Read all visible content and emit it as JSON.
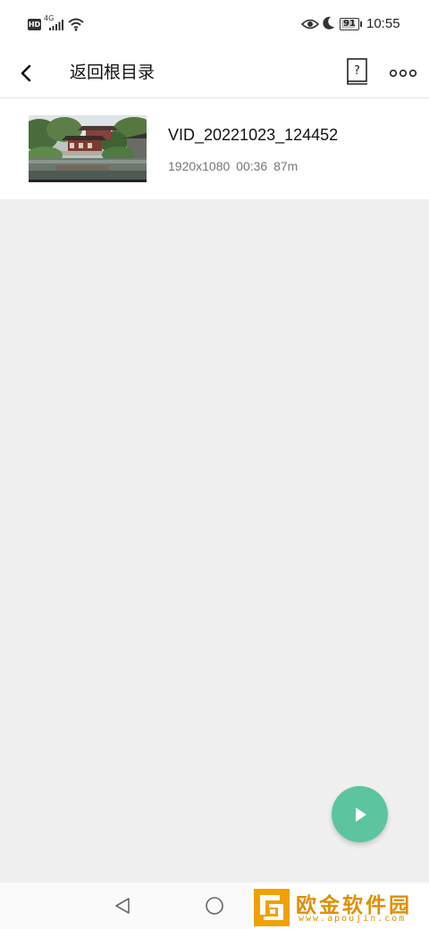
{
  "status_bar": {
    "hd": "HD",
    "network": "4G",
    "battery": "91",
    "battery_level": 0.91,
    "time": "10:55"
  },
  "app_bar": {
    "title": "返回根目录",
    "help_glyph": "?",
    "icons": [
      "chevron-left-icon",
      "help-book-icon",
      "more-horizontal-icon"
    ]
  },
  "videos": [
    {
      "name": "VID_20221023_124452",
      "meta": "1920x1080  00:36  87m",
      "thumbnail": "pavilion-lake-thumbnail"
    }
  ],
  "fab": {
    "icon": "play-icon",
    "color": "#5cc59e"
  },
  "nav": {
    "icons": [
      "nav-back-icon",
      "nav-home-icon"
    ]
  },
  "watermark": {
    "name": "欧金软件园",
    "url": "www.apoujin.com",
    "color": "#e08f00"
  }
}
